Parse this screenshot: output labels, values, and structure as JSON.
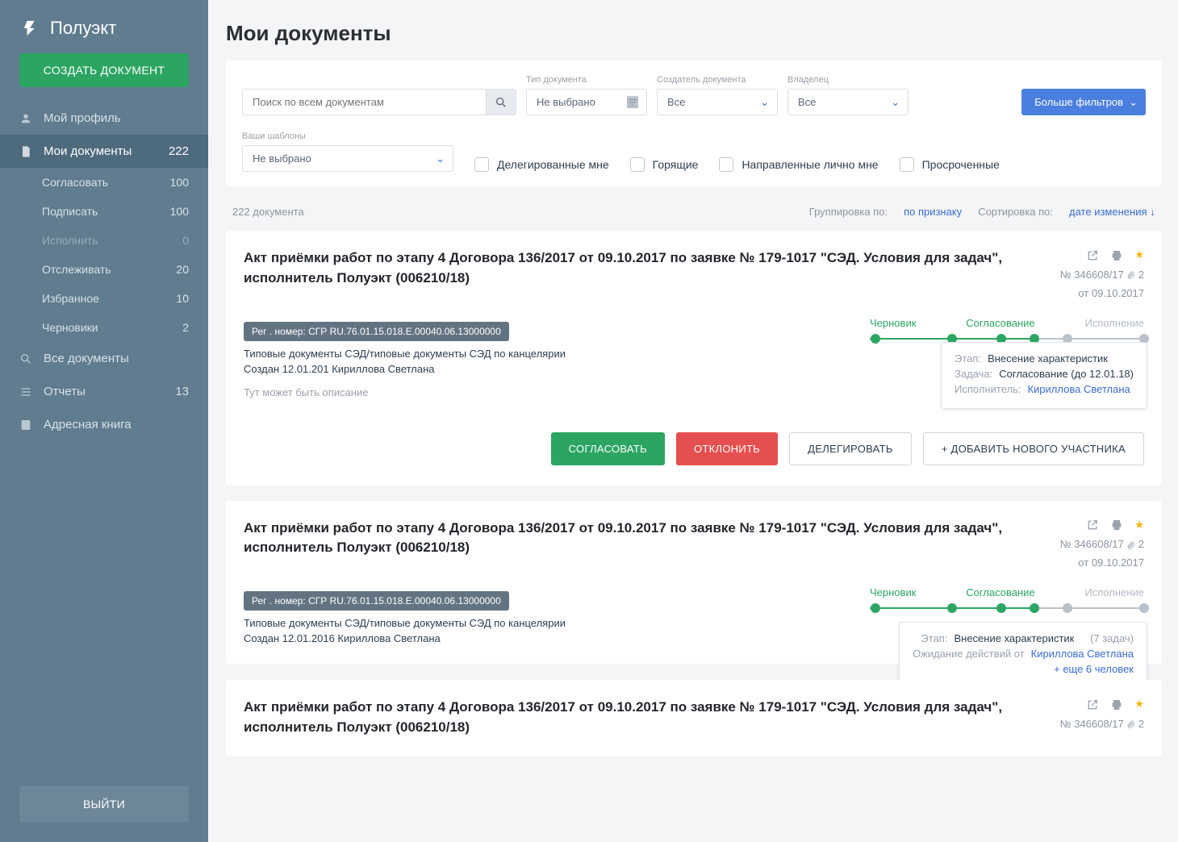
{
  "app": {
    "name": "Полуэкт",
    "create_button": "СОЗДАТЬ ДОКУМЕНТ",
    "logout": "ВЫЙТИ"
  },
  "sidebar": {
    "profile": "Мой профиль",
    "my_docs": {
      "label": "Мои документы",
      "count": "222"
    },
    "sub": {
      "approve": {
        "label": "Согласовать",
        "count": "100"
      },
      "sign": {
        "label": "Подписать",
        "count": "100"
      },
      "execute": {
        "label": "Исполнить",
        "count": "0"
      },
      "watch": {
        "label": "Отслеживать",
        "count": "20"
      },
      "fav": {
        "label": "Избранное",
        "count": "10"
      },
      "drafts": {
        "label": "Черновики",
        "count": "2"
      }
    },
    "all_docs": "Все документы",
    "reports": {
      "label": "Отчеты",
      "count": "13"
    },
    "addressbook": "Адресная книга"
  },
  "page": {
    "title": "Мои документы"
  },
  "filters": {
    "search_placeholder": "Поиск по всем документам",
    "doc_type": {
      "label": "Тип документа",
      "value": "Не выбрано"
    },
    "creator": {
      "label": "Создатель документа",
      "value": "Все"
    },
    "owner": {
      "label": "Владелец",
      "value": "Все"
    },
    "more": "Больше фильтров",
    "templates": {
      "label": "Ваши шаблоны",
      "value": "Не выбрано"
    },
    "chk_delegated": "Делегированные мне",
    "chk_hot": "Горящие",
    "chk_personal": "Направленные лично мне",
    "chk_overdue": "Просроченные"
  },
  "meta": {
    "count": "222 документа",
    "group_label": "Группировка по:",
    "group_value": "по признаку",
    "sort_label": "Сортировка по:",
    "sort_value": "дате изменения"
  },
  "wf": {
    "draft": "Черновик",
    "approve": "Согласование",
    "execute": "Исполнение"
  },
  "cards": [
    {
      "title": "Акт приёмки работ по этапу 4 Договора 136/2017 от 09.10.2017 по заявке № 179-1017 \"СЭД. Условия для задач\", исполнитель  Полуэкт (006210/18)",
      "number": "№ 346608/17",
      "attach": "2",
      "date": "от 09.10.2017",
      "reg": "Рег . номер: СГР RU.76.01.15.018.Е.00040.06.13000000",
      "type": "Типовые документы СЭД/типовые документы СЭД по канцелярии",
      "created": "Создан 12.01.201  Кириллова Светлана",
      "desc": "Тут может быть описание",
      "popup": {
        "stage_k": "Этап:",
        "stage_v": "Внесение характеристик",
        "task_k": "Задача:",
        "task_v": "Согласование  (до 12.01.18)",
        "exec_k": "Исполнитель:",
        "exec_v": "Кириллова Светлана"
      },
      "actions": {
        "approve": "СОГЛАСОВАТЬ",
        "decline": "ОТКЛОНИТЬ",
        "delegate": "ДЕЛЕГИРОВАТЬ",
        "add": "+ ДОБАВИТЬ НОВОГО УЧАСТНИКА"
      }
    },
    {
      "title": "Акт приёмки работ по этапу 4 Договора 136/2017 от 09.10.2017 по заявке № 179-1017 \"СЭД. Условия для задач\", исполнитель  Полуэкт (006210/18)",
      "number": "№ 346608/17",
      "attach": "2",
      "date": "от 09.10.2017",
      "reg": "Рег . номер: СГР RU.76.01.15.018.Е.00040.06.13000000",
      "type": "Типовые документы СЭД/типовые документы СЭД по канцелярии",
      "created": "Создан 12.01.2016  Кириллова Светлана",
      "popup": {
        "stage_k": "Этап:",
        "stage_v": "Внесение характеристик",
        "stage_extra": "(7 задач)",
        "wait_k": "Ожидание действий от",
        "wait_v": "Кириллова Светлана",
        "wait_extra": "+ еще 6 человек"
      }
    },
    {
      "title": "Акт приёмки работ по этапу 4 Договора 136/2017 от 09.10.2017 по заявке № 179-1017 \"СЭД. Условия для задач\", исполнитель  Полуэкт (006210/18)",
      "number": "№ 346608/17",
      "attach": "2"
    }
  ]
}
